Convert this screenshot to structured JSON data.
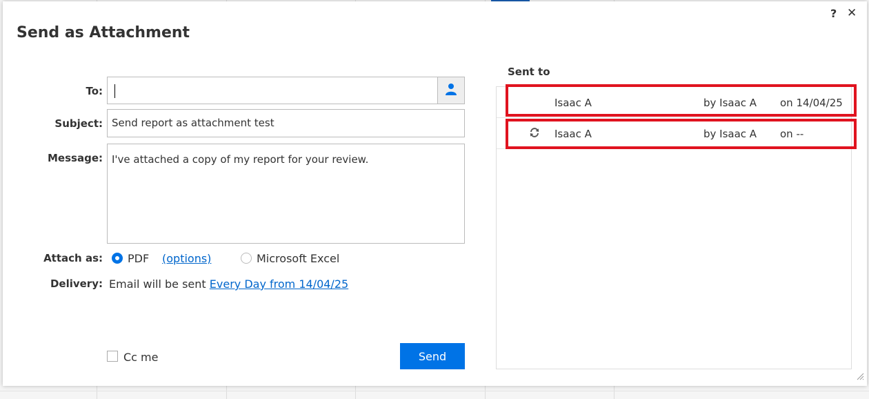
{
  "dialog": {
    "title": "Send as Attachment",
    "help_icon": "?",
    "close_icon": "✕"
  },
  "form": {
    "to_label": "To:",
    "to_value": "",
    "subject_label": "Subject:",
    "subject_value": "Send report as attachment test",
    "message_label": "Message:",
    "message_value": "I've attached a copy of my report for your review.",
    "attach_label": "Attach as:",
    "attach_options": [
      {
        "label": "PDF",
        "selected": true
      },
      {
        "label": "Microsoft Excel",
        "selected": false
      }
    ],
    "options_link": "(options)",
    "delivery_label": "Delivery:",
    "delivery_text": "Email will be sent",
    "delivery_link": "Every Day from 14/04/25",
    "cc_label": "Cc me",
    "cc_checked": false,
    "send_label": "Send"
  },
  "sent_to": {
    "title": "Sent to",
    "rows": [
      {
        "recurring": false,
        "name": "Isaac A",
        "by": "by Isaac A",
        "on": "on 14/04/25"
      },
      {
        "recurring": true,
        "name": "Isaac A",
        "by": "by Isaac A",
        "on": "on --"
      }
    ]
  },
  "colors": {
    "accent": "#0073e6",
    "highlight": "#e0131f"
  },
  "icons": {
    "contact": "person-icon",
    "refresh": "refresh-icon",
    "resize": "resize-grip-icon"
  }
}
